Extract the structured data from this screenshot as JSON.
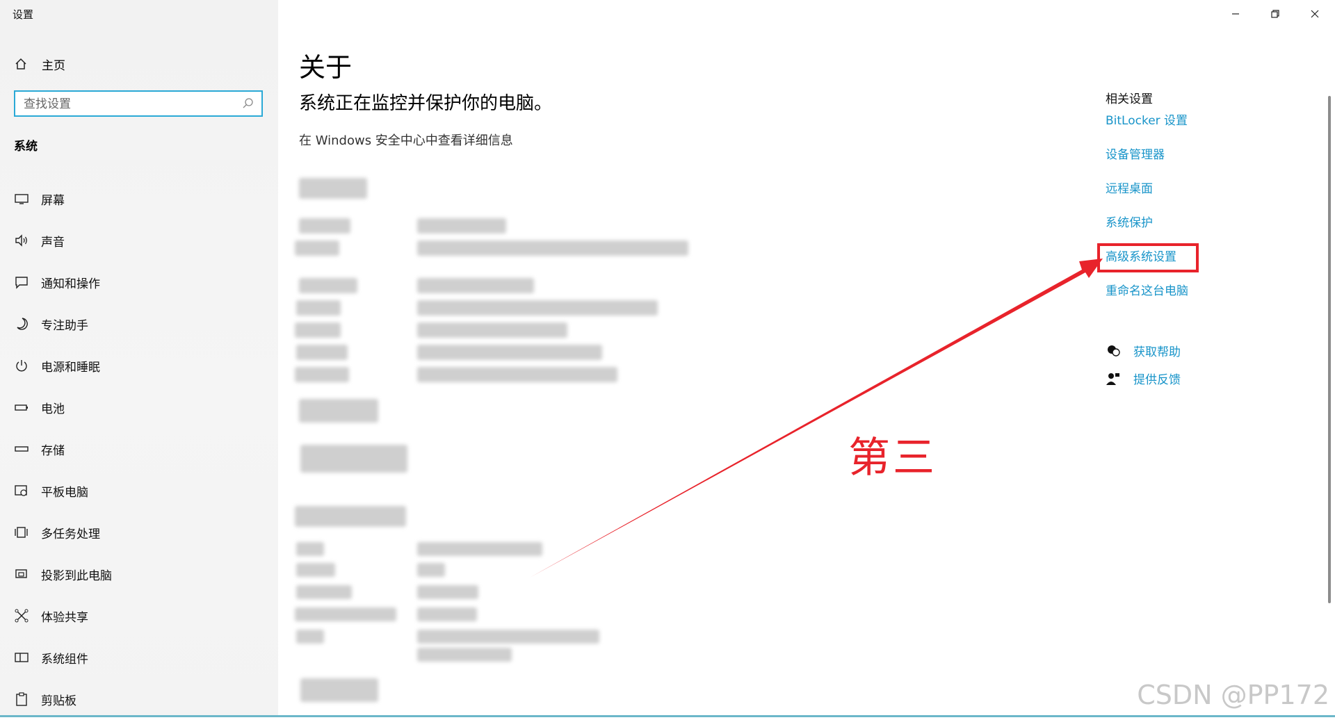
{
  "window": {
    "title": "设置"
  },
  "sidebar": {
    "home_label": "主页",
    "search_placeholder": "查找设置",
    "section_label": "系统",
    "items": [
      {
        "label": "屏幕",
        "icon": "monitor-icon"
      },
      {
        "label": "声音",
        "icon": "speaker-icon"
      },
      {
        "label": "通知和操作",
        "icon": "notification-icon"
      },
      {
        "label": "专注助手",
        "icon": "moon-icon"
      },
      {
        "label": "电源和睡眠",
        "icon": "power-icon"
      },
      {
        "label": "电池",
        "icon": "battery-icon"
      },
      {
        "label": "存储",
        "icon": "storage-icon"
      },
      {
        "label": "平板电脑",
        "icon": "tablet-icon"
      },
      {
        "label": "多任务处理",
        "icon": "multitask-icon"
      },
      {
        "label": "投影到此电脑",
        "icon": "project-icon"
      },
      {
        "label": "体验共享",
        "icon": "share-icon"
      },
      {
        "label": "系统组件",
        "icon": "components-icon"
      },
      {
        "label": "剪贴板",
        "icon": "clipboard-icon"
      }
    ]
  },
  "main": {
    "title": "关于",
    "status_heading": "系统正在监控并保护你的电脑。",
    "status_link": "在 Windows 安全中心中查看详细信息"
  },
  "related": {
    "title": "相关设置",
    "links": [
      "BitLocker 设置",
      "设备管理器",
      "远程桌面",
      "系统保护",
      "高级系统设置",
      "重命名这台电脑"
    ],
    "help": "获取帮助",
    "feedback": "提供反馈"
  },
  "annotation": {
    "text": "第三",
    "color": "#e8232b"
  },
  "watermark": "CSDN @PP172",
  "colors": {
    "link": "#1894c9",
    "search_border": "#2aa9d6",
    "annotation": "#e8232b"
  }
}
